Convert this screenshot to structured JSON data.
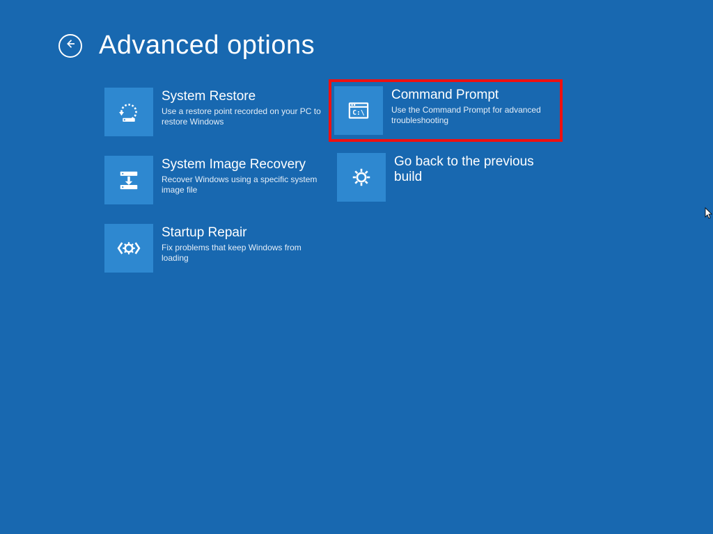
{
  "header": {
    "title": "Advanced options"
  },
  "colors": {
    "background": "#1868b0",
    "tile_bg": "#2e88d0",
    "highlight_border": "#ef1010"
  },
  "options": {
    "col1": [
      {
        "icon": "system-restore-icon",
        "title": "System Restore",
        "desc": "Use a restore point recorded on your PC to restore Windows"
      },
      {
        "icon": "system-image-recovery-icon",
        "title": "System Image Recovery",
        "desc": "Recover Windows using a specific system image file"
      },
      {
        "icon": "startup-repair-icon",
        "title": "Startup Repair",
        "desc": "Fix problems that keep Windows from loading"
      }
    ],
    "col2": [
      {
        "icon": "command-prompt-icon",
        "title": "Command Prompt",
        "desc": "Use the Command Prompt for advanced troubleshooting",
        "highlighted": true
      },
      {
        "icon": "go-back-icon",
        "title": "Go back to the previous build",
        "desc": ""
      }
    ]
  }
}
